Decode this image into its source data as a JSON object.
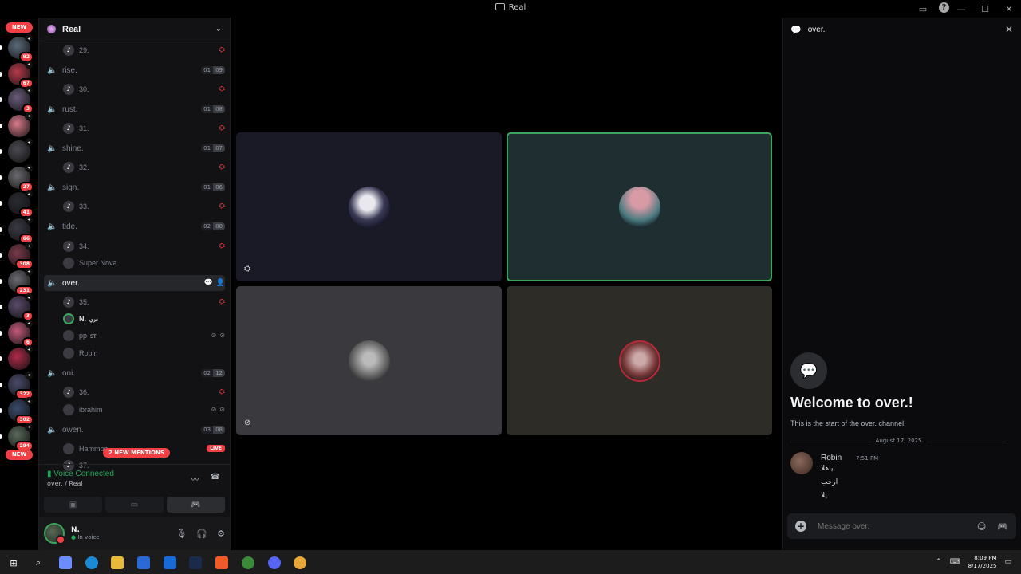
{
  "window": {
    "title": "Real"
  },
  "rail": {
    "top_pill": "NEW",
    "bottom_pill": "NEW",
    "servers": [
      {
        "badge": "92",
        "color": "#5b6b7a"
      },
      {
        "badge": "67",
        "color": "#b73a4a"
      },
      {
        "badge": "3",
        "color": "#6a5b7a"
      },
      {
        "badge": "",
        "color": "#d97a8a"
      },
      {
        "badge": "",
        "color": "#4a4a52"
      },
      {
        "badge": "27",
        "color": "#6b6b70"
      },
      {
        "badge": "41",
        "color": "#2a2a33"
      },
      {
        "badge": "66",
        "color": "#3a3a44"
      },
      {
        "badge": "308",
        "color": "#7a3a4a"
      },
      {
        "badge": "231",
        "color": "#6a6a72"
      },
      {
        "badge": "3",
        "color": "#5a4a6a"
      },
      {
        "badge": "6",
        "color": "#c25a7a"
      },
      {
        "badge": "",
        "color": "#b02a4a"
      },
      {
        "badge": "322",
        "color": "#4a4a6a"
      },
      {
        "badge": "302",
        "color": "#3a4a6a"
      },
      {
        "badge": "294",
        "color": "#5a6a5a"
      }
    ]
  },
  "sidebar": {
    "guild_name": "Real",
    "channels": [
      {
        "kind": "user",
        "name": "29.",
        "icon": "red"
      },
      {
        "kind": "vc",
        "name": "rise.",
        "limit": [
          "01",
          "09"
        ]
      },
      {
        "kind": "user",
        "name": "30.",
        "icon": "red"
      },
      {
        "kind": "vc",
        "name": "rust.",
        "limit": [
          "01",
          "08"
        ]
      },
      {
        "kind": "user",
        "name": "31.",
        "icon": "red"
      },
      {
        "kind": "vc",
        "name": "shine.",
        "limit": [
          "01",
          "07"
        ]
      },
      {
        "kind": "user",
        "name": "32.",
        "icon": "red"
      },
      {
        "kind": "vc",
        "name": "sign.",
        "limit": [
          "01",
          "06"
        ]
      },
      {
        "kind": "user",
        "name": "33.",
        "icon": "red"
      },
      {
        "kind": "vc",
        "name": "tide.",
        "limit": [
          "02",
          "08"
        ]
      },
      {
        "kind": "user",
        "name": "34.",
        "icon": "red"
      },
      {
        "kind": "user",
        "name": "Super Nova",
        "icon": ""
      },
      {
        "kind": "vc",
        "name": "over.",
        "active": true
      },
      {
        "kind": "user",
        "name": "35.",
        "icon": "red"
      },
      {
        "kind": "user",
        "name": "N.",
        "tag": "عزي",
        "bright": true,
        "icon": ""
      },
      {
        "kind": "user",
        "name": "pp",
        "tag": "STI",
        "icon": "mute"
      },
      {
        "kind": "user",
        "name": "Robin",
        "icon": ""
      },
      {
        "kind": "vc",
        "name": "oni.",
        "limit": [
          "02",
          "12"
        ]
      },
      {
        "kind": "user",
        "name": "36.",
        "icon": "red"
      },
      {
        "kind": "user",
        "name": "ibrahim",
        "icon": "mute"
      },
      {
        "kind": "vc",
        "name": "owen.",
        "limit": [
          "03",
          "08"
        ]
      },
      {
        "kind": "user",
        "name": "Hammoo...",
        "icon": "live"
      },
      {
        "kind": "user",
        "name": "37.",
        "icon": ""
      }
    ],
    "mentions_pill": "2 NEW MENTIONS",
    "live_label": "LIVE"
  },
  "voice": {
    "status": "Voice Connected",
    "where": "over. / Real"
  },
  "user_panel": {
    "name": "N.",
    "status": "In voice"
  },
  "chat": {
    "channel": "over.",
    "welcome_title": "Welcome to over.!",
    "welcome_sub": "This is the start of the over. channel.",
    "date_divider": "August 17, 2025",
    "message": {
      "author": "Robin",
      "time": "7:51 PM",
      "lines": [
        "ياهلا",
        "ارحب",
        "يلا"
      ]
    },
    "placeholder": "Message over."
  },
  "taskbar": {
    "time": "8:09 PM",
    "date": "8/17/2025"
  },
  "colors": {
    "accent_green": "#23a55a",
    "danger": "#f23f43",
    "speaking_border": "#3ba55c"
  }
}
